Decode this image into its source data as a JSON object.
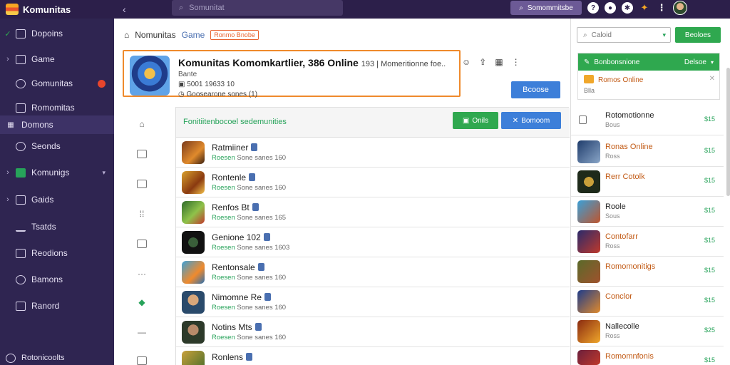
{
  "app": {
    "title": "Komunitas"
  },
  "topbar": {
    "search_placeholder": "Somunitat",
    "cta_label": "Somommitsbe",
    "icons": [
      "question-icon",
      "bell-icon",
      "settings-icon",
      "fire-icon",
      "more-icon"
    ]
  },
  "sidebar": {
    "items": [
      {
        "label": "Dopoins"
      },
      {
        "label": "Game"
      },
      {
        "label": "Gomunitas"
      },
      {
        "label": "Romomitas"
      },
      {
        "label": "Domons"
      },
      {
        "label": "Seonds"
      },
      {
        "label": "Komunigs"
      },
      {
        "label": "Gaids"
      },
      {
        "label": "Tsatds"
      },
      {
        "label": "Reodions"
      },
      {
        "label": "Bamons"
      },
      {
        "label": "Ranord"
      }
    ],
    "footer_label": "Rotonicoolts"
  },
  "breadcrumb": {
    "title": "Nomunitas",
    "game": "Game",
    "tag": "Ronmo Bnobe"
  },
  "hero": {
    "title": "Komunitas Komomkartlier, 386 Online",
    "title_extra": "193 | Momeritionne foe..",
    "meta1": "Bante",
    "meta2": "5001 19633   10",
    "meta3": "Goosearone sones (1)",
    "action_label": "Bcoose"
  },
  "list": {
    "header_label": "Fonitiitenbocoel sedemunities",
    "green_btn": "Onils",
    "blue_btn": "Bomoom",
    "rows": [
      {
        "name": "Ratmiiner",
        "sub_a": "Roesen",
        "sub_b": "Sone sanes 160"
      },
      {
        "name": "Rontenle",
        "sub_a": "Roesen",
        "sub_b": "Sone sanes 160"
      },
      {
        "name": "Renfos  Bt",
        "sub_a": "Roesen",
        "sub_b": "Sone sanes 165"
      },
      {
        "name": "Genione 102",
        "sub_a": "Roesen",
        "sub_b": "Sone sanes 1603"
      },
      {
        "name": "Rentonsale",
        "sub_a": "Roesen",
        "sub_b": "Sone sanes 160"
      },
      {
        "name": "Nimomne Re",
        "sub_a": "Roesen",
        "sub_b": "Sone sanes 160"
      },
      {
        "name": "Notins Mts",
        "sub_a": "Roesen",
        "sub_b": "Sone sanes 160"
      },
      {
        "name": "Ronlens",
        "sub_a": "",
        "sub_b": ""
      }
    ]
  },
  "right": {
    "search_placeholder": "Caloid",
    "button_label": "Beoloes",
    "featured": {
      "header": "Bonbonsnione",
      "header_right": "Delsoe",
      "title": "Romos Online",
      "sub": "Blla"
    },
    "rows": [
      {
        "name": "Rotomotionne",
        "sub": "Bous",
        "price": "$15"
      },
      {
        "name": "Ronas Online",
        "sub": "Ross",
        "price": "$15"
      },
      {
        "name": "Rerr Cotolk",
        "sub": "",
        "price": "$15"
      },
      {
        "name": "Roole",
        "sub": "Sous",
        "price": "$15"
      },
      {
        "name": "Contofarr",
        "sub": "Ross",
        "price": "$15"
      },
      {
        "name": "Romomonitigs",
        "sub": "",
        "price": "$15"
      },
      {
        "name": "Conclor",
        "sub": "",
        "price": "$15"
      },
      {
        "name": "Nallecolle",
        "sub": "Ross",
        "price": "$25"
      },
      {
        "name": "Romomnfonis",
        "sub": "",
        "price": "$15"
      }
    ]
  }
}
